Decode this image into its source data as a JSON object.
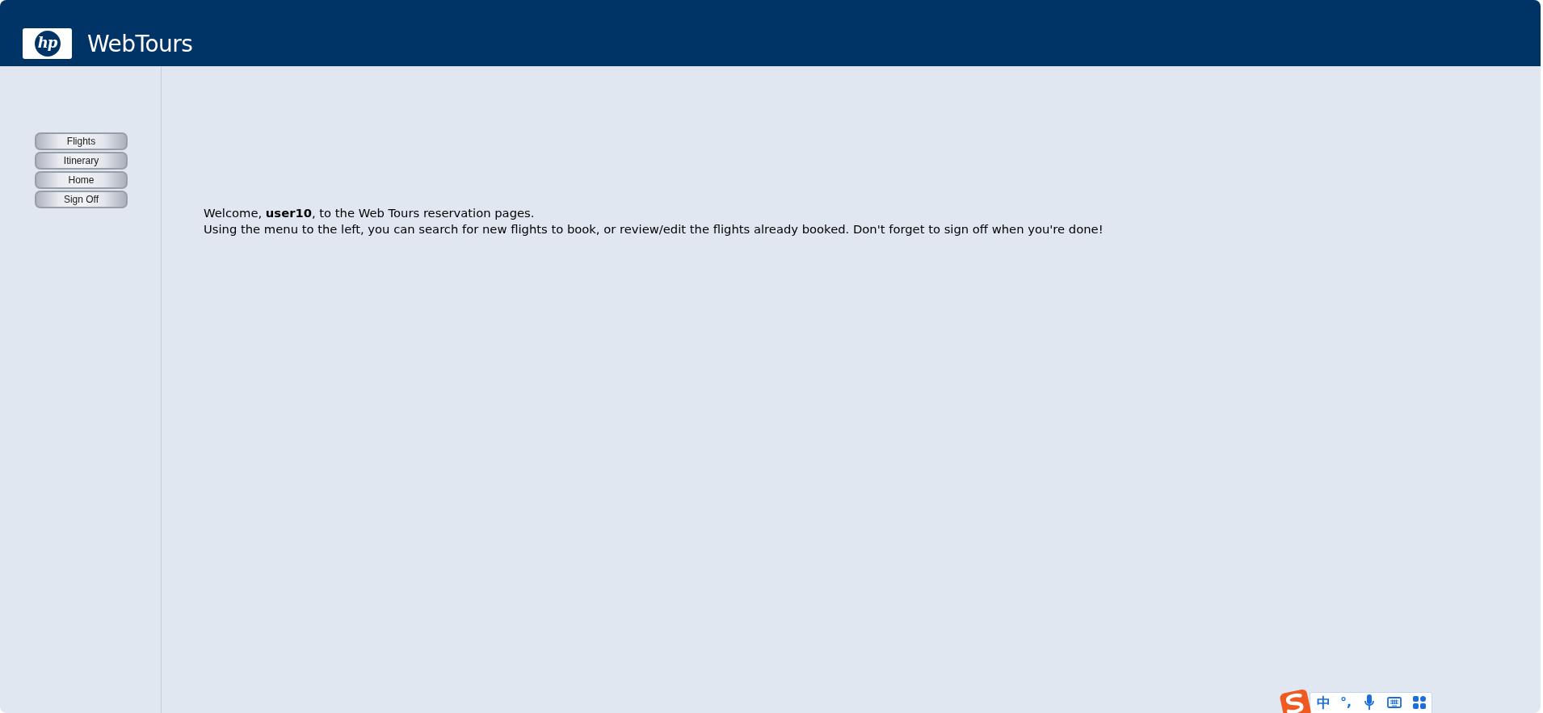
{
  "header": {
    "logo_mark": "hp",
    "title": "WebTours"
  },
  "menu": [
    {
      "label": "Flights"
    },
    {
      "label": "Itinerary"
    },
    {
      "label": "Home"
    },
    {
      "label": "Sign Off"
    }
  ],
  "welcome": {
    "greeting": "Welcome, **user10**, to the Web Tours reservation pages.",
    "instructions": "Using the menu to the left, you can search for new flights to book, or review/edit the flights already booked. Don't forget to sign off when you're done!"
  },
  "ime_toolbar": {
    "language": "中",
    "punctuation": "°,"
  }
}
